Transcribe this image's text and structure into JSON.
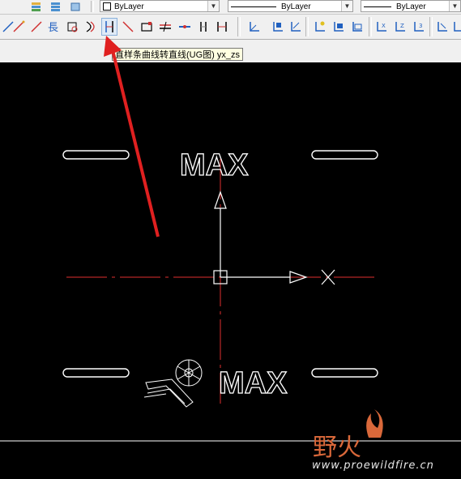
{
  "toolbar": {
    "layer_dropdown": "ByLayer",
    "color_dropdown": "ByLayer",
    "linetype_dropdown": "ByLayer",
    "lineweight_dropdown": "ByLayer",
    "tooltip": "直样条曲线转直线(UG图) yx_zs",
    "button_icons": [
      "line-icon",
      "line-icon",
      "measure-icon",
      "circle-icon",
      "arc-icon",
      "spline-to-line-icon",
      "diagonal-icon",
      "rectangle-icon",
      "break-icon",
      "extend-icon",
      "trim-icon",
      "dimension-icon",
      "ucs-icon",
      "ucs-icon",
      "ucs-icon",
      "ucs-icon",
      "ucs-icon",
      "ucs-icon",
      "ucs-icon",
      "ucs-icon",
      "ucs-icon",
      "ucs-icon",
      "ucs-icon"
    ]
  },
  "drawing": {
    "text_top": "MAX",
    "text_bottom": "MAX"
  },
  "watermark": {
    "site_cn": "野火",
    "url": "www.proewildfire.cn"
  }
}
